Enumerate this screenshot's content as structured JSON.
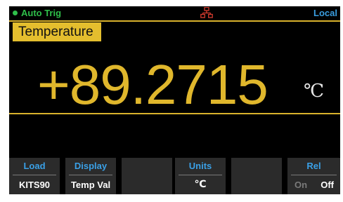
{
  "status_bar": {
    "trigger_label": "Auto Trig",
    "trigger_color": "#2fbf4a",
    "network_icon": "lan-network-icon",
    "remote_label": "Local",
    "remote_color": "#3a9ee0"
  },
  "function_tag": {
    "label": "Temperature",
    "color": "#e4be2e"
  },
  "measurement": {
    "value": "+89.2715",
    "unit": "℃",
    "color": "#e0b72c"
  },
  "softkeys": [
    {
      "title": "Load",
      "value": "KITS90"
    },
    {
      "title": "Display",
      "value": "Temp Val"
    },
    {
      "title": "",
      "value": ""
    },
    {
      "title": "Units",
      "value": "℃"
    },
    {
      "title": "",
      "value": ""
    },
    {
      "title": "Rel",
      "options": [
        "On",
        "Off"
      ],
      "selected": "Off"
    }
  ]
}
